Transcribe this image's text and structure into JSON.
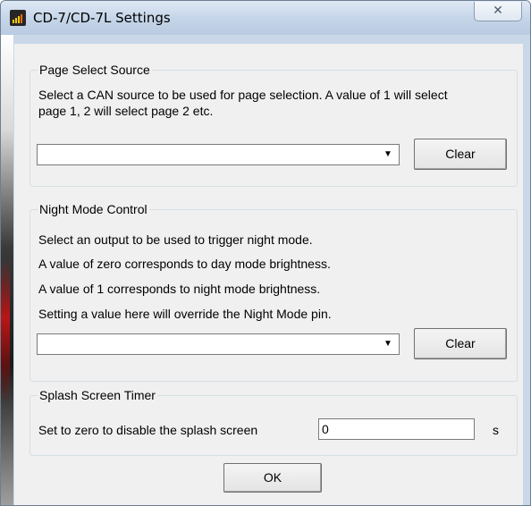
{
  "window": {
    "title": "CD-7/CD-7L Settings",
    "close_glyph": "✕"
  },
  "page_select": {
    "title": "Page Select Source",
    "desc_line1": "Select a CAN source to be used for page selection. A value of 1 will select",
    "desc_line2": "page 1, 2 will select page 2  etc.",
    "combo_value": "",
    "clear_label": "Clear"
  },
  "night_mode": {
    "title": "Night Mode Control",
    "lines": [
      "Select an output to be used to trigger night mode.",
      "A value of zero corresponds to day mode brightness.",
      "A value of 1 corresponds to night mode brightness.",
      "Setting a value here will override the Night Mode pin."
    ],
    "combo_value": "",
    "clear_label": "Clear"
  },
  "splash": {
    "title": "Splash Screen Timer",
    "label": "Set to zero to disable the splash screen",
    "value": "0",
    "unit": "s"
  },
  "ok_label": "OK",
  "icons": {
    "dropdown": "▼"
  }
}
